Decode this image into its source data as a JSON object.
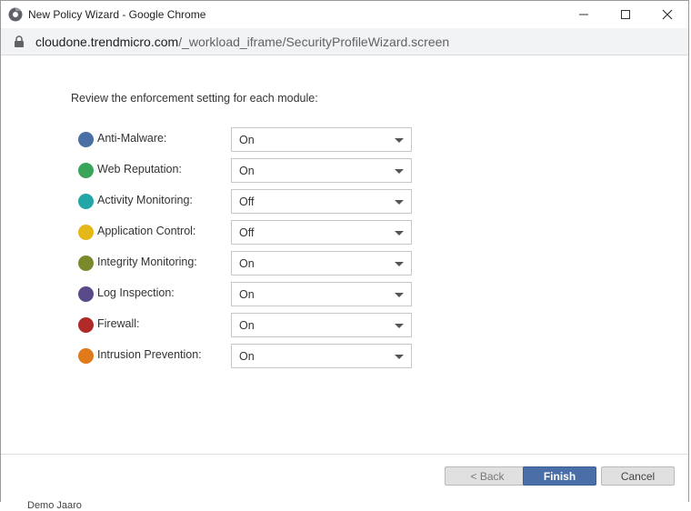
{
  "window": {
    "title": "New Policy Wizard - Google Chrome"
  },
  "address": {
    "host": "cloudone.trendmicro.com",
    "path": "/_workload_iframe/SecurityProfileWizard.screen"
  },
  "intro": "Review the enforcement setting for each module:",
  "modules": [
    {
      "label": "Anti-Malware:",
      "value": "On",
      "icon": "anti-malware-icon",
      "color": "#4a6fa5"
    },
    {
      "label": "Web Reputation:",
      "value": "On",
      "icon": "web-reputation-icon",
      "color": "#3aa55a"
    },
    {
      "label": "Activity Monitoring:",
      "value": "Off",
      "icon": "activity-monitoring-icon",
      "color": "#22a6a6"
    },
    {
      "label": "Application Control:",
      "value": "Off",
      "icon": "application-control-icon",
      "color": "#e5b81a"
    },
    {
      "label": "Integrity Monitoring:",
      "value": "On",
      "icon": "integrity-monitoring-icon",
      "color": "#7a8a2a"
    },
    {
      "label": "Log Inspection:",
      "value": "On",
      "icon": "log-inspection-icon",
      "color": "#5a4a8a"
    },
    {
      "label": "Firewall:",
      "value": "On",
      "icon": "firewall-icon",
      "color": "#b02a2a"
    },
    {
      "label": "Intrusion Prevention:",
      "value": "On",
      "icon": "intrusion-prevention-icon",
      "color": "#e07a1a"
    }
  ],
  "buttons": {
    "back": "< Back",
    "finish": "Finish",
    "cancel": "Cancel"
  },
  "below_window": "Demo Jaaro"
}
